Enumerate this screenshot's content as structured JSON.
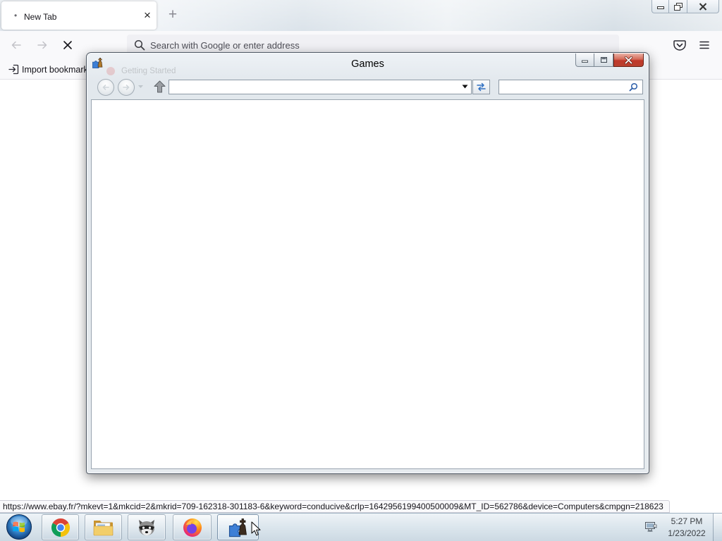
{
  "browser": {
    "tab": {
      "dot": "•",
      "label": "New Tab",
      "close": "×"
    },
    "new_tab": "+",
    "address_bar": {
      "placeholder": "Search with Google or enter address",
      "value": ""
    },
    "bookmarks_toolbar": {
      "import_label": "Import bookmark"
    },
    "ghost_bookmark": "Getting Started",
    "status_url": "https://www.ebay.fr/?mkevt=1&mkcid=2&mkrid=709-162318-301183-6&keyword=conducive&crlp=1642956199400500009&MT_ID=562786&device=Computers&cmpgn=218623",
    "icons": {
      "back": "back-arrow-icon",
      "forward": "forward-arrow-icon",
      "stop": "stop-icon",
      "search": "search-icon",
      "pocket": "pocket-icon",
      "menu": "hamburger-menu-icon",
      "import": "import-icon"
    }
  },
  "explorer_window": {
    "title": "Games",
    "icon": "games-icon",
    "address_value": "",
    "search_value": ""
  },
  "taskbar": {
    "start": "windows-start-orb-icon",
    "apps": [
      {
        "icon": "chrome-icon"
      },
      {
        "icon": "windows-explorer-icon"
      },
      {
        "icon": "raccoon-icon"
      },
      {
        "icon": "firefox-icon"
      },
      {
        "icon": "games-icon",
        "active": true
      }
    ],
    "tray_icon": "action-center-icon",
    "clock": {
      "time": "5:27 PM",
      "date": "1/23/2022"
    }
  },
  "colors": {
    "caption_close": "#c0392b",
    "window_frame": "#e6ebef",
    "taskbar_glass": "#dde7ee"
  }
}
